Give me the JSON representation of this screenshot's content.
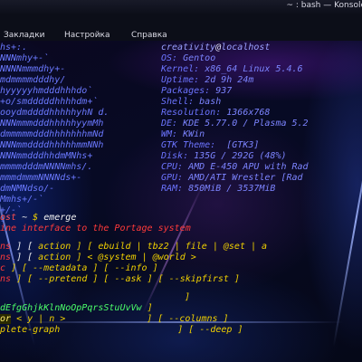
{
  "window": {
    "title": "~ : bash — Konsole"
  },
  "menubar": {
    "items": [
      "Закладки",
      "Настройка",
      "Справка"
    ]
  },
  "logo_lines": [
    "hs+:.",
    "NNNmhy+-`",
    "NNNNmmmdhy+-",
    "mdmmmmdddhy/",
    "hyyyyyhmdddhhhdo`",
    "+o/smdddddhhhhdm+`",
    "ooydmddddhhhhhyhN d.",
    "NNNmmmdddhhhhhyymMh",
    "dmmmmmdddhhhhhhhmNd",
    "NNNmmddddhhhhhmmNNh",
    "NNNmmdddhhdmMNhs+",
    "mmmmdddmNNNNmhs/.",
    "mmmdmmmNNNNds+-",
    "dmNMNdso/-",
    "Mmhs+/-`",
    "+/-`",
    "-`"
  ],
  "userhost": {
    "user": "creativity",
    "at": "@",
    "host": "localhost"
  },
  "sysinfo": [
    {
      "key": "OS:",
      "value": "Gentoo"
    },
    {
      "key": "Kernel:",
      "value": "x86_64 Linux 5.4.6"
    },
    {
      "key": "Uptime:",
      "value": "2d 9h 24m"
    },
    {
      "key": "Packages:",
      "value": "937"
    },
    {
      "key": "Shell:",
      "value": "bash"
    },
    {
      "key": "Resolution:",
      "value": "1366x768"
    },
    {
      "key": "DE:",
      "value": "KDE 5.77.0 / Plasma 5.2"
    },
    {
      "key": "WM:",
      "value": "KWin"
    },
    {
      "key": "GTK Theme:",
      "value": "[GTK3]"
    },
    {
      "key": "Disk:",
      "value": "135G / 292G (48%)"
    },
    {
      "key": "CPU:",
      "value": "AMD E-450 APU with Rad"
    },
    {
      "key": "GPU:",
      "value": "AMD/ATI Wrestler [Rad"
    },
    {
      "key": "RAM:",
      "value": "850MiB / 3537MiB"
    }
  ],
  "prompt": {
    "host": "ost",
    "path": "~",
    "symbol": "$",
    "command": "emerge"
  },
  "output": {
    "description": "ine interface to the Portage system",
    "usage_row1": {
      "a": "ns",
      "b": "] [",
      "c": "action",
      "d": "] [ ebuild | tbz2 | file | @set | a"
    },
    "usage_row2": {
      "a": "ns",
      "b": "] [",
      "c": "action",
      "d": "] < @system | @world >"
    },
    "usage_row3": {
      "a": "c",
      "b": "] [ --metadata ] [ --info ]"
    },
    "usage_row4": {
      "a": "ns",
      "b": "] [ --pretend ] [ --ask ] [ --skipfirst ]"
    },
    "usage_row5": {
      "a": "",
      "b": "]"
    },
    "usage_row6": {
      "a": "dEfgGhjkKlnNoOpPqrsStuUvVw",
      "b": "]"
    },
    "usage_row7": {
      "a": "or",
      "b": " < y | n >",
      "c": "] [ --columns ]"
    },
    "usage_row8": {
      "a": "plete-graph",
      "b": "] [ --deep ]"
    }
  }
}
